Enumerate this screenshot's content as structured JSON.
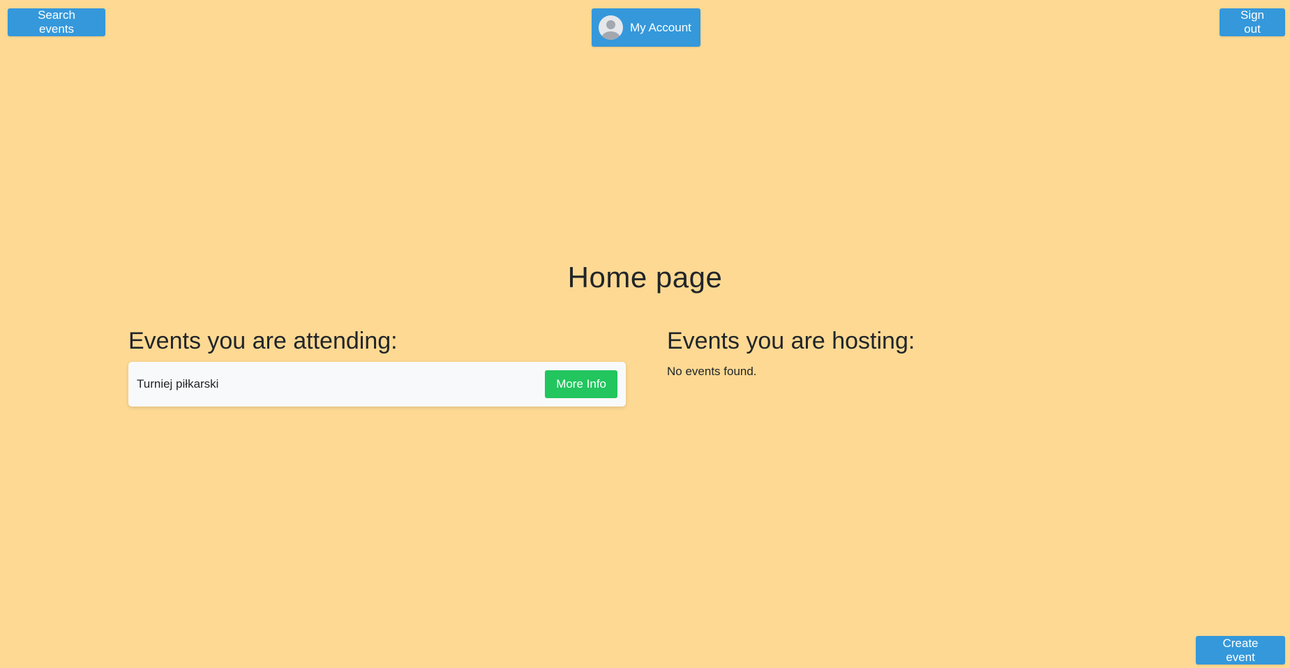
{
  "header": {
    "search_label": "Search events",
    "account_label": "My Account",
    "signout_label": "Sign out"
  },
  "page_title": "Home page",
  "attending": {
    "heading": "Events you are attending:",
    "events": [
      {
        "name": "Turniej piłkarski",
        "button_label": "More Info"
      }
    ]
  },
  "hosting": {
    "heading": "Events you are hosting:",
    "empty_text": "No events found."
  },
  "footer": {
    "create_label": "Create event"
  },
  "colors": {
    "background": "#fdd993",
    "primary_button": "#3498db",
    "success_button": "#22c55e",
    "card": "#f8f9fb"
  }
}
